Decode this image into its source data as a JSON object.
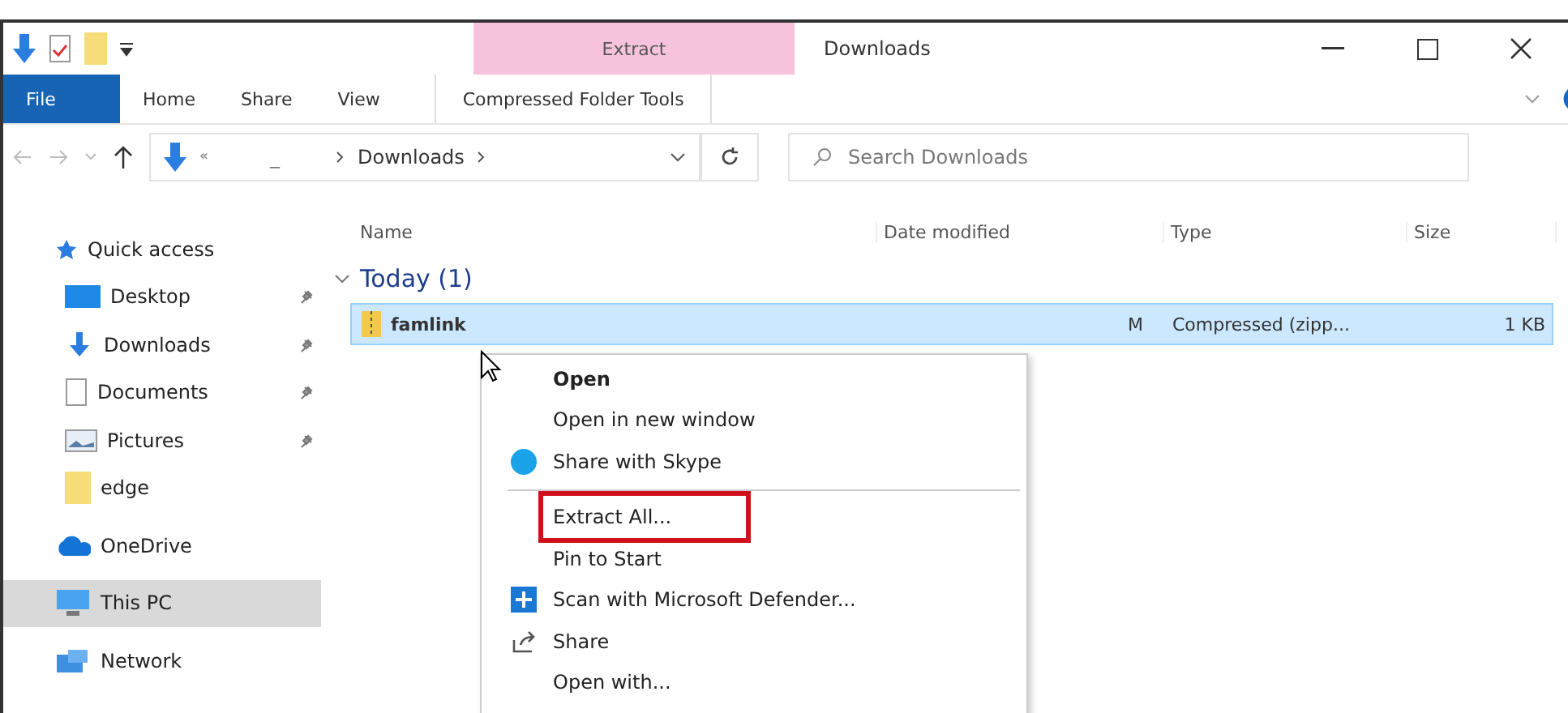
{
  "window": {
    "title": "Downloads",
    "context_tab": "Extract"
  },
  "ribbon": {
    "tabs": [
      {
        "label": "File",
        "kind": "file",
        "selected": false
      },
      {
        "label": "Home",
        "kind": "tab",
        "selected": false
      },
      {
        "label": "Share",
        "kind": "tab",
        "selected": false
      },
      {
        "label": "View",
        "kind": "tab",
        "selected": false
      },
      {
        "label": "Compressed Folder Tools",
        "kind": "context",
        "selected": true
      }
    ]
  },
  "address": {
    "prefix": "«",
    "crumb_1": "_",
    "current": "Downloads"
  },
  "search": {
    "placeholder": "Search Downloads"
  },
  "sidebar": {
    "items": [
      {
        "label": "Quick access",
        "kind": "star",
        "pinned": false,
        "selected": false
      },
      {
        "label": "Desktop",
        "kind": "desktop",
        "pinned": true,
        "selected": false
      },
      {
        "label": "Downloads",
        "kind": "download",
        "pinned": true,
        "selected": false
      },
      {
        "label": "Documents",
        "kind": "document",
        "pinned": true,
        "selected": false
      },
      {
        "label": "Pictures",
        "kind": "picture",
        "pinned": true,
        "selected": false
      },
      {
        "label": "edge",
        "kind": "folder",
        "pinned": false,
        "selected": false
      },
      {
        "label": "OneDrive",
        "kind": "cloud",
        "pinned": false,
        "selected": false
      },
      {
        "label": "This PC",
        "kind": "pc",
        "pinned": false,
        "selected": true
      },
      {
        "label": "Network",
        "kind": "network",
        "pinned": false,
        "selected": false
      }
    ]
  },
  "table": {
    "columns": [
      "Name",
      "Date modified",
      "Type",
      "Size"
    ],
    "group": "Today (1)",
    "rows": [
      {
        "name": "famlink",
        "date": "M",
        "type": "Compressed (zipp...",
        "size": "1 KB",
        "selected": true
      }
    ]
  },
  "context_menu": {
    "items": [
      {
        "label": "Open",
        "kind": "default",
        "highlighted": false
      },
      {
        "label": "Open in new window",
        "kind": "plain",
        "highlighted": false
      },
      {
        "label": "Share with Skype",
        "kind": "skype",
        "highlighted": false
      },
      {
        "kind": "separator"
      },
      {
        "label": "Extract All...",
        "kind": "plain",
        "highlighted": true
      },
      {
        "label": "Pin to Start",
        "kind": "plain",
        "highlighted": false
      },
      {
        "label": "Scan with Microsoft Defender...",
        "kind": "defender",
        "highlighted": false
      },
      {
        "label": "Share",
        "kind": "share",
        "highlighted": false
      },
      {
        "label": "Open with...",
        "kind": "plain",
        "highlighted": false
      }
    ]
  }
}
